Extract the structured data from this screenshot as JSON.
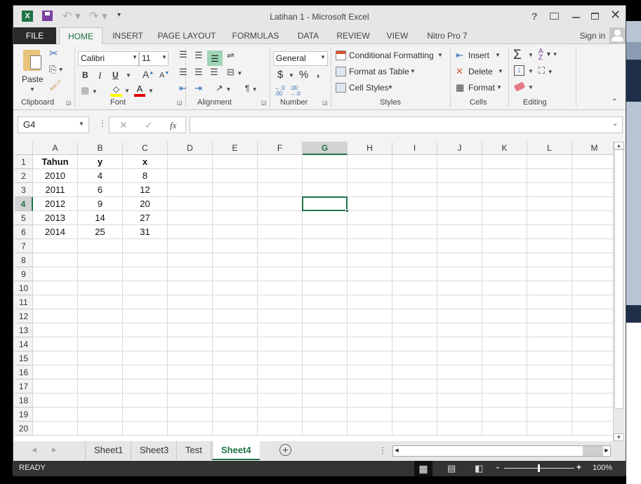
{
  "window": {
    "title": "Latihan 1 - Microsoft Excel",
    "help": "?",
    "sign_in": "Sign in"
  },
  "ribbon_tabs": [
    "FILE",
    "HOME",
    "INSERT",
    "PAGE LAYOUT",
    "FORMULAS",
    "DATA",
    "REVIEW",
    "VIEW",
    "Nitro Pro 7"
  ],
  "active_tab": "HOME",
  "clipboard": {
    "paste": "Paste",
    "label": "Clipboard"
  },
  "font": {
    "name": "Calibri",
    "size": "11",
    "bold": "B",
    "italic": "I",
    "underline": "U",
    "label": "Font",
    "fill_color": "#ffff00",
    "font_color": "#e00000"
  },
  "alignment": {
    "label": "Alignment"
  },
  "number": {
    "format": "General",
    "currency": "$",
    "percent": "%",
    "comma": ",",
    "inc_dec": "←.0 .00",
    "dec_dec": ".00 →.0",
    "label": "Number"
  },
  "styles": {
    "conditional": "Conditional Formatting",
    "format_table": "Format as Table",
    "cell_styles": "Cell Styles",
    "label": "Styles"
  },
  "cells": {
    "insert": "Insert",
    "delete": "Delete",
    "format": "Format",
    "label": "Cells"
  },
  "editing": {
    "sum": "Σ",
    "label": "Editing"
  },
  "formula_bar": {
    "name_box": "G4",
    "fx": "fx",
    "cancel": "✕",
    "enter": "✓",
    "value": ""
  },
  "grid": {
    "columns": [
      "A",
      "B",
      "C",
      "D",
      "E",
      "F",
      "G",
      "H",
      "I",
      "J",
      "K",
      "L",
      "M"
    ],
    "rows": [
      "1",
      "2",
      "3",
      "4",
      "5",
      "6",
      "7",
      "8",
      "9",
      "10",
      "11",
      "12",
      "13",
      "14",
      "15",
      "16",
      "17",
      "18",
      "19",
      "20"
    ],
    "selected_cell": "G4",
    "selected_col": "G",
    "selected_row": "4",
    "cells": [
      [
        "Tahun",
        "y",
        "x"
      ],
      [
        "2010",
        "4",
        "8"
      ],
      [
        "2011",
        "6",
        "12"
      ],
      [
        "2012",
        "9",
        "20"
      ],
      [
        "2013",
        "14",
        "27"
      ],
      [
        "2014",
        "25",
        "31"
      ]
    ]
  },
  "sheets": [
    "Sheet1",
    "Sheet3",
    "Test",
    "Sheet4"
  ],
  "active_sheet": "Sheet4",
  "status": {
    "text": "READY",
    "zoom": "100%"
  },
  "accent": "#217346"
}
